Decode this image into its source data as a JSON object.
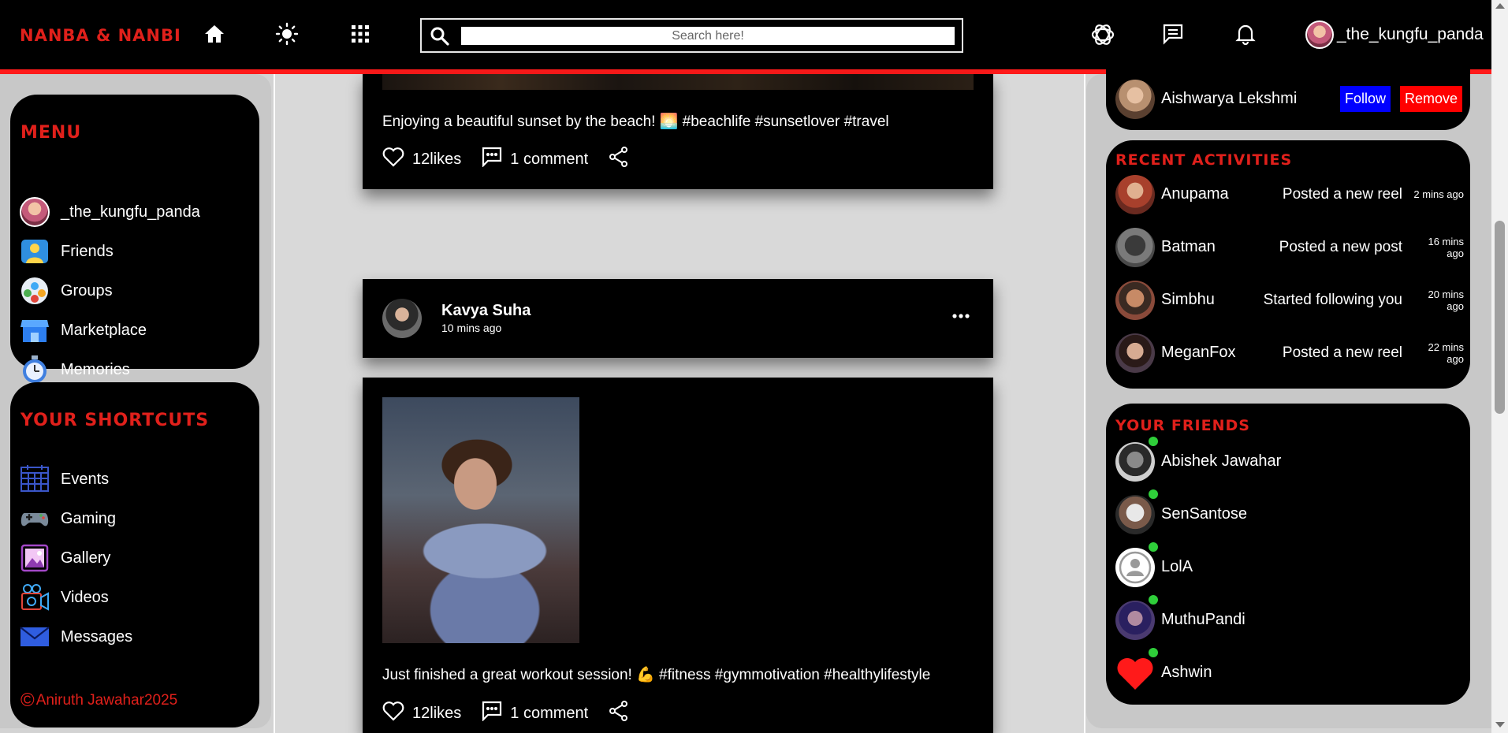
{
  "header": {
    "brand": "NANBA & NANBI",
    "search_placeholder": "Search here!",
    "username": "_the_kungfu_panda"
  },
  "menu": {
    "title": "MENU",
    "items": [
      {
        "label": "_the_kungfu_panda",
        "icon": "avatar"
      },
      {
        "label": "Friends",
        "icon": "friends-icon"
      },
      {
        "label": "Groups",
        "icon": "groups-icon"
      },
      {
        "label": "Marketplace",
        "icon": "marketplace-icon"
      },
      {
        "label": "Memories",
        "icon": "memories-icon"
      }
    ]
  },
  "shortcuts": {
    "title": "YOUR SHORTCUTS",
    "items": [
      {
        "label": "Events",
        "icon": "calendar-icon"
      },
      {
        "label": "Gaming",
        "icon": "gamepad-icon"
      },
      {
        "label": "Gallery",
        "icon": "gallery-icon"
      },
      {
        "label": "Videos",
        "icon": "video-camera-icon"
      },
      {
        "label": "Messages",
        "icon": "mail-icon"
      }
    ],
    "footer_symbol": "©",
    "footer": "Aniruth Jawahar2025"
  },
  "posts": [
    {
      "caption": "Enjoying a beautiful sunset by the beach! 🌅 #beachlife #sunsetlover #travel",
      "likes": "12likes",
      "comments": "1 comment"
    },
    {
      "author": "Kavya Suha",
      "time": "10 mins ago",
      "caption": "Just finished a great workout session! 💪 #fitness #gymmotivation #healthylifestyle",
      "likes": "12likes",
      "comments": "1 comment"
    }
  ],
  "suggestion": {
    "name": "Aishwarya Lekshmi",
    "follow": "Follow",
    "remove": "Remove"
  },
  "activities": {
    "title": "RECENT ACTIVITIES",
    "items": [
      {
        "name": "Anupama",
        "action": "Posted a new reel",
        "time": "2 mins ago"
      },
      {
        "name": "Batman",
        "action": "Posted a new post",
        "time": "16 mins ago"
      },
      {
        "name": "Simbhu",
        "action": "Started following you",
        "time": "20 mins ago"
      },
      {
        "name": "MeganFox",
        "action": "Posted a new reel",
        "time": "22 mins ago"
      }
    ]
  },
  "friends": {
    "title": "YOUR FRIENDS",
    "items": [
      {
        "name": "Abishek Jawahar"
      },
      {
        "name": "SenSantose"
      },
      {
        "name": "LolA"
      },
      {
        "name": "MuthuPandi"
      },
      {
        "name": "Ashwin"
      }
    ]
  },
  "colors": {
    "brand_red": "#e0201b",
    "follow_blue": "#0000ff",
    "remove_red": "#ff0000",
    "online_green": "#2fce3a"
  }
}
